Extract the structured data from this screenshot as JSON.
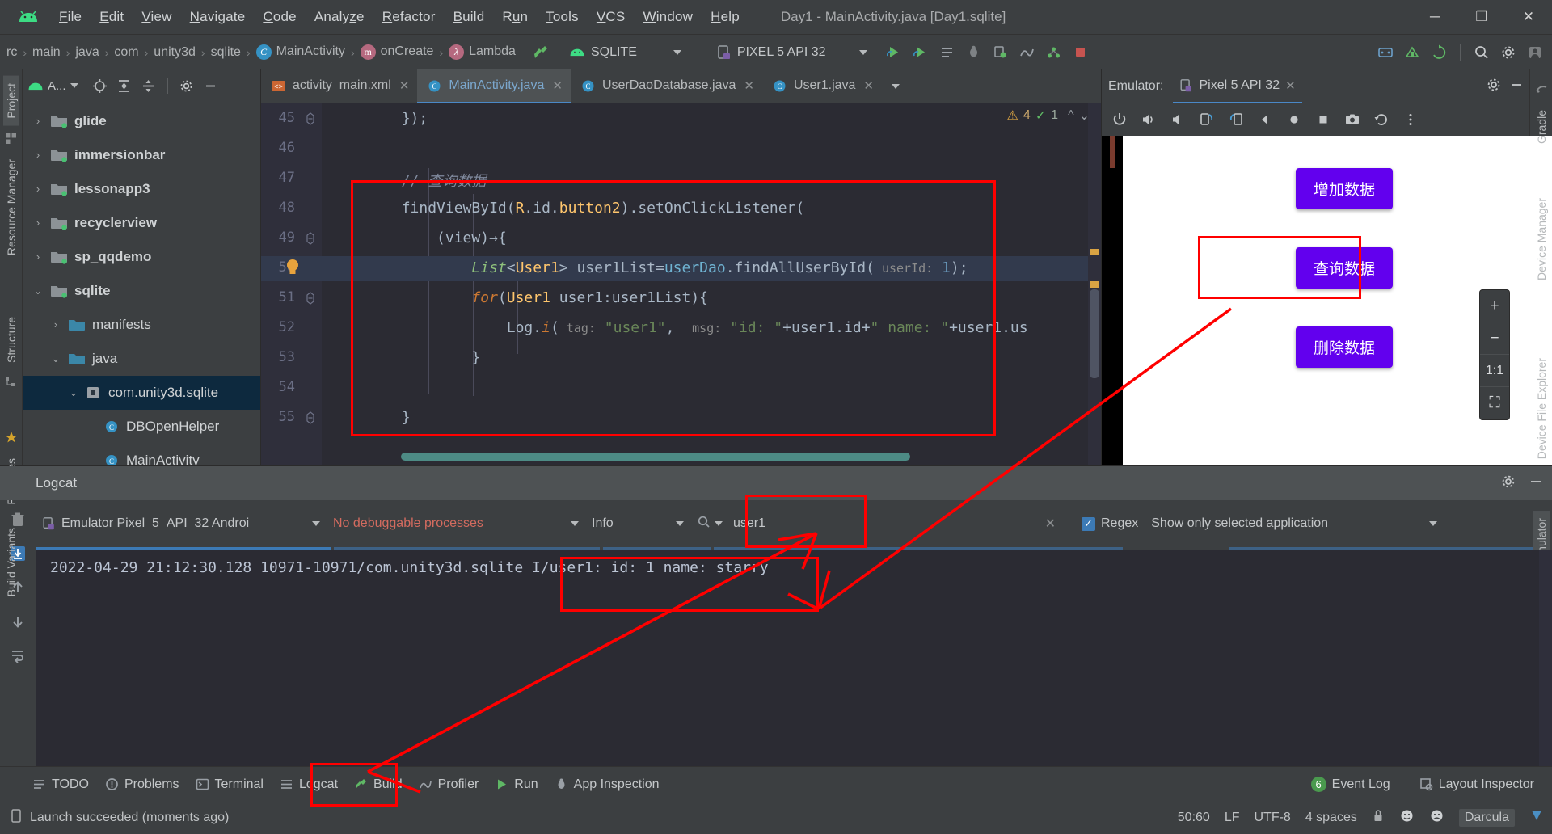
{
  "window": {
    "title": "Day1 - MainActivity.java [Day1.sqlite]",
    "minimize": "─",
    "maximize": "❐",
    "close": "✕"
  },
  "menu": [
    {
      "label": "File",
      "mnemonic": "F"
    },
    {
      "label": "Edit",
      "mnemonic": "E"
    },
    {
      "label": "View",
      "mnemonic": "V"
    },
    {
      "label": "Navigate",
      "mnemonic": "N"
    },
    {
      "label": "Code",
      "mnemonic": "C"
    },
    {
      "label": "Analyze",
      "mnemonic": "z"
    },
    {
      "label": "Refactor",
      "mnemonic": "R"
    },
    {
      "label": "Build",
      "mnemonic": "B"
    },
    {
      "label": "Run",
      "mnemonic": "u"
    },
    {
      "label": "Tools",
      "mnemonic": "T"
    },
    {
      "label": "VCS",
      "mnemonic": "V"
    },
    {
      "label": "Window",
      "mnemonic": "W"
    },
    {
      "label": "Help",
      "mnemonic": "H"
    }
  ],
  "breadcrumbs": [
    {
      "label": "rc",
      "icon": null
    },
    {
      "label": "main",
      "icon": null
    },
    {
      "label": "java",
      "icon": null
    },
    {
      "label": "com",
      "icon": null
    },
    {
      "label": "unity3d",
      "icon": null
    },
    {
      "label": "sqlite",
      "icon": null
    },
    {
      "label": "MainActivity",
      "icon": "class-icon",
      "glyph": "C"
    },
    {
      "label": "onCreate",
      "icon": "method-icon",
      "glyph": "m"
    },
    {
      "label": "Lambda",
      "icon": "lambda-icon",
      "glyph": "λ"
    }
  ],
  "toolbar": {
    "run_config": "SQLITE",
    "device": "PIXEL 5 API 32",
    "build_icon": "hammer-icon",
    "sync_icon": "gradle-sync-icon"
  },
  "project_panel": {
    "title": "A...",
    "tree": [
      {
        "label": "glide",
        "arrow": "›",
        "kind": "module",
        "depth": 0,
        "bold": true
      },
      {
        "label": "immersionbar",
        "arrow": "›",
        "kind": "module",
        "depth": 0,
        "bold": true
      },
      {
        "label": "lessonapp3",
        "arrow": "›",
        "kind": "module",
        "depth": 0,
        "bold": true
      },
      {
        "label": "recyclerview",
        "arrow": "›",
        "kind": "module",
        "depth": 0,
        "bold": true
      },
      {
        "label": "sp_qqdemo",
        "arrow": "›",
        "kind": "module",
        "depth": 0,
        "bold": true
      },
      {
        "label": "sqlite",
        "arrow": "⌄",
        "kind": "module",
        "depth": 0,
        "bold": true
      },
      {
        "label": "manifests",
        "arrow": "›",
        "kind": "folder",
        "depth": 1,
        "bold": false
      },
      {
        "label": "java",
        "arrow": "⌄",
        "kind": "folder",
        "depth": 1,
        "bold": false
      },
      {
        "label": "com.unity3d.sqlite",
        "arrow": "⌄",
        "kind": "package",
        "depth": 2,
        "bold": false,
        "selected": true
      },
      {
        "label": "DBOpenHelper",
        "arrow": "",
        "kind": "class",
        "depth": 3,
        "bold": false
      },
      {
        "label": "MainActivity",
        "arrow": "",
        "kind": "class",
        "depth": 3,
        "bold": false
      }
    ]
  },
  "editor": {
    "tabs": [
      {
        "label": "activity_main.xml",
        "icon": "xml-icon",
        "active": false
      },
      {
        "label": "MainActivity.java",
        "icon": "java-class-icon",
        "active": true
      },
      {
        "label": "UserDaoDatabase.java",
        "icon": "java-class-icon",
        "active": false
      },
      {
        "label": "User1.java",
        "icon": "java-class-icon",
        "active": false
      }
    ],
    "warnings": {
      "count": "4",
      "icon": "warning-icon"
    },
    "checks": {
      "count": "1",
      "icon": "check-icon"
    },
    "lines": [
      {
        "no": "45",
        "segments": [
          {
            "t": "        });",
            "c": "plain"
          }
        ]
      },
      {
        "no": "46",
        "segments": [
          {
            "t": "",
            "c": "plain"
          }
        ]
      },
      {
        "no": "47",
        "segments": [
          {
            "t": "        ",
            "c": "plain"
          },
          {
            "t": "// 查询数据",
            "c": "cmt"
          }
        ]
      },
      {
        "no": "48",
        "segments": [
          {
            "t": "        findViewById(",
            "c": "plain"
          },
          {
            "t": "R",
            "c": "fn"
          },
          {
            "t": ".id.",
            "c": "plain"
          },
          {
            "t": "button2",
            "c": "fn"
          },
          {
            "t": ").setOnClickListener(",
            "c": "plain"
          }
        ]
      },
      {
        "no": "49",
        "segments": [
          {
            "t": "            (view)→{",
            "c": "plain"
          }
        ]
      },
      {
        "no": "50",
        "segments": [
          {
            "t": "                ",
            "c": "plain"
          },
          {
            "t": "List",
            "c": "typ-italic"
          },
          {
            "t": "<",
            "c": "plain"
          },
          {
            "t": "User1",
            "c": "fn"
          },
          {
            "t": "> user1List=",
            "c": "plain"
          },
          {
            "t": "userDao",
            "c": "m"
          },
          {
            "t": ".findAllUserById(",
            "c": "plain"
          },
          {
            "t": " userId:",
            "c": "hint"
          },
          {
            "t": " ",
            "c": "plain"
          },
          {
            "t": "1",
            "c": "num"
          },
          {
            "t": ");",
            "c": "plain"
          }
        ],
        "highlight": true
      },
      {
        "no": "51",
        "segments": [
          {
            "t": "                ",
            "c": "plain"
          },
          {
            "t": "for",
            "c": "kw-italic"
          },
          {
            "t": "(",
            "c": "plain"
          },
          {
            "t": "User1",
            "c": "fn"
          },
          {
            "t": " user1:user1List){",
            "c": "plain"
          }
        ]
      },
      {
        "no": "52",
        "segments": [
          {
            "t": "                    Log.",
            "c": "plain"
          },
          {
            "t": "i",
            "c": "kw-italic"
          },
          {
            "t": "(",
            "c": "plain"
          },
          {
            "t": " tag:",
            "c": "hint"
          },
          {
            "t": " ",
            "c": "plain"
          },
          {
            "t": "\"user1\"",
            "c": "s"
          },
          {
            "t": ",  ",
            "c": "plain"
          },
          {
            "t": "msg:",
            "c": "hint"
          },
          {
            "t": " ",
            "c": "plain"
          },
          {
            "t": "\"id: \"",
            "c": "s"
          },
          {
            "t": "+user1.id+",
            "c": "plain"
          },
          {
            "t": "\" name: \"",
            "c": "s"
          },
          {
            "t": "+user1.us",
            "c": "plain"
          }
        ]
      },
      {
        "no": "53",
        "segments": [
          {
            "t": "                }",
            "c": "plain"
          }
        ]
      },
      {
        "no": "54",
        "segments": [
          {
            "t": "",
            "c": "plain"
          }
        ]
      },
      {
        "no": "55",
        "segments": [
          {
            "t": "        }",
            "c": "plain"
          }
        ]
      }
    ]
  },
  "emulator": {
    "label": "Emulator:",
    "tab": "Pixel 5 API 32",
    "close": "✕",
    "toolbar_icons": [
      "power-icon",
      "volume-up-icon",
      "volume-down-icon",
      "rotate-left-icon",
      "rotate-right-icon",
      "back-icon",
      "home-icon",
      "overview-icon",
      "screenshot-icon",
      "history-icon",
      "more-icon"
    ],
    "settings_icon": "gear-icon",
    "minimize_icon": "minimize-icon",
    "zoom_controls": [
      {
        "label": "+",
        "name": "zoom-in-button"
      },
      {
        "label": "−",
        "name": "zoom-out-button"
      },
      {
        "label": "1:1",
        "name": "zoom-actual-button"
      },
      {
        "label": "⛶",
        "name": "zoom-fit-button"
      }
    ],
    "app_buttons": [
      {
        "label": "增加数据",
        "name": "add-data-button"
      },
      {
        "label": "查询数据",
        "name": "query-data-button"
      },
      {
        "label": "删除数据",
        "name": "delete-data-button"
      }
    ],
    "button_color": "#6200ee"
  },
  "logcat": {
    "title": "Logcat",
    "device": "Emulator Pixel_5_API_32 Androi",
    "process": "No debuggable processes",
    "level": "Info",
    "search_value": "user1",
    "search_icon": "search-icon",
    "clear_icon": "✕",
    "regex_label": "Regex",
    "regex_checked": true,
    "scope": "Show only selected application",
    "settings_icon": "gear-icon",
    "minimize_icon": "minimize-icon",
    "rail_icons": [
      "trash-icon",
      "scroll-to-end-icon",
      "up-icon",
      "down-icon",
      "soft-wrap-icon"
    ],
    "output": [
      "2022-04-29 21:12:30.128 10971-10971/com.unity3d.sqlite I/user1: id: 1 name: starry"
    ]
  },
  "tool_windows": {
    "left": [
      {
        "label": "TODO",
        "icon": "todo-icon"
      },
      {
        "label": "Problems",
        "icon": "problems-icon"
      },
      {
        "label": "Terminal",
        "icon": "terminal-icon"
      },
      {
        "label": "Logcat",
        "icon": "logcat-icon",
        "highlighted": true
      },
      {
        "label": "Build",
        "icon": "build-icon"
      },
      {
        "label": "Profiler",
        "icon": "profiler-icon"
      },
      {
        "label": "Run",
        "icon": "run-icon"
      },
      {
        "label": "App Inspection",
        "icon": "app-inspection-icon"
      }
    ],
    "right": [
      {
        "label": "Event Log",
        "icon": "event-log-icon",
        "badge": "6"
      },
      {
        "label": "Layout Inspector",
        "icon": "layout-inspector-icon"
      }
    ]
  },
  "left_rail": [
    {
      "label": "Project",
      "selected": true
    },
    {
      "label": "Resource Manager",
      "selected": false
    },
    {
      "label": "Structure",
      "selected": false
    },
    {
      "label": "Favorites",
      "selected": false
    },
    {
      "label": "Build Variants",
      "selected": false
    }
  ],
  "right_rail": [
    {
      "label": "Gradle"
    },
    {
      "label": "Device Manager"
    },
    {
      "label": "Device File Explorer"
    },
    {
      "label": "Emulator"
    }
  ],
  "status_bar": {
    "message": "Launch succeeded (moments ago)",
    "caret": "50:60",
    "line_sep": "LF",
    "encoding": "UTF-8",
    "indent": "4 spaces",
    "theme": "Darcula"
  }
}
